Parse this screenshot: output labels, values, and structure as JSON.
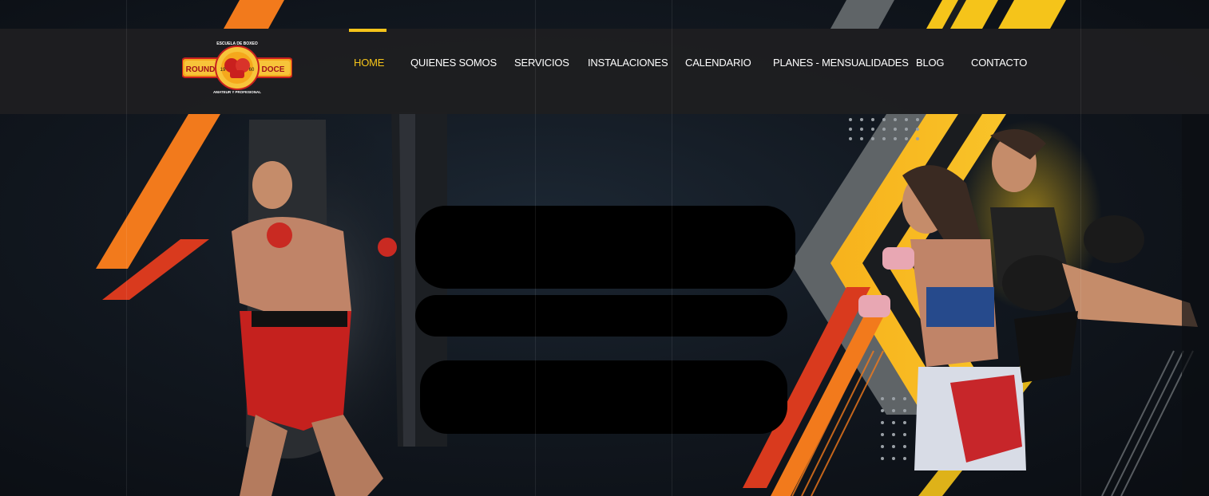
{
  "logo": {
    "left_text": "ROUND",
    "right_text": "DOCE",
    "arc_top": "ESCUELA DE BOXEO",
    "arc_bottom": "AMATEUR Y PROFESIONAL",
    "year_left": "19",
    "year_right": "60"
  },
  "nav": {
    "items": [
      {
        "label": "HOME",
        "active": true
      },
      {
        "label": "QUIENES SOMOS"
      },
      {
        "label": "SERVICIOS"
      },
      {
        "label": "INSTALACIONES"
      },
      {
        "label": "CALENDARIO"
      },
      {
        "label": "PLANES - MENSUALIDADES"
      },
      {
        "label": "BLOG"
      },
      {
        "label": "CONTACTO"
      }
    ]
  },
  "colors": {
    "accent": "#f5c41a",
    "orange": "#f27a1c",
    "red": "#d93a1e",
    "header_bg": "#1e1e20"
  }
}
